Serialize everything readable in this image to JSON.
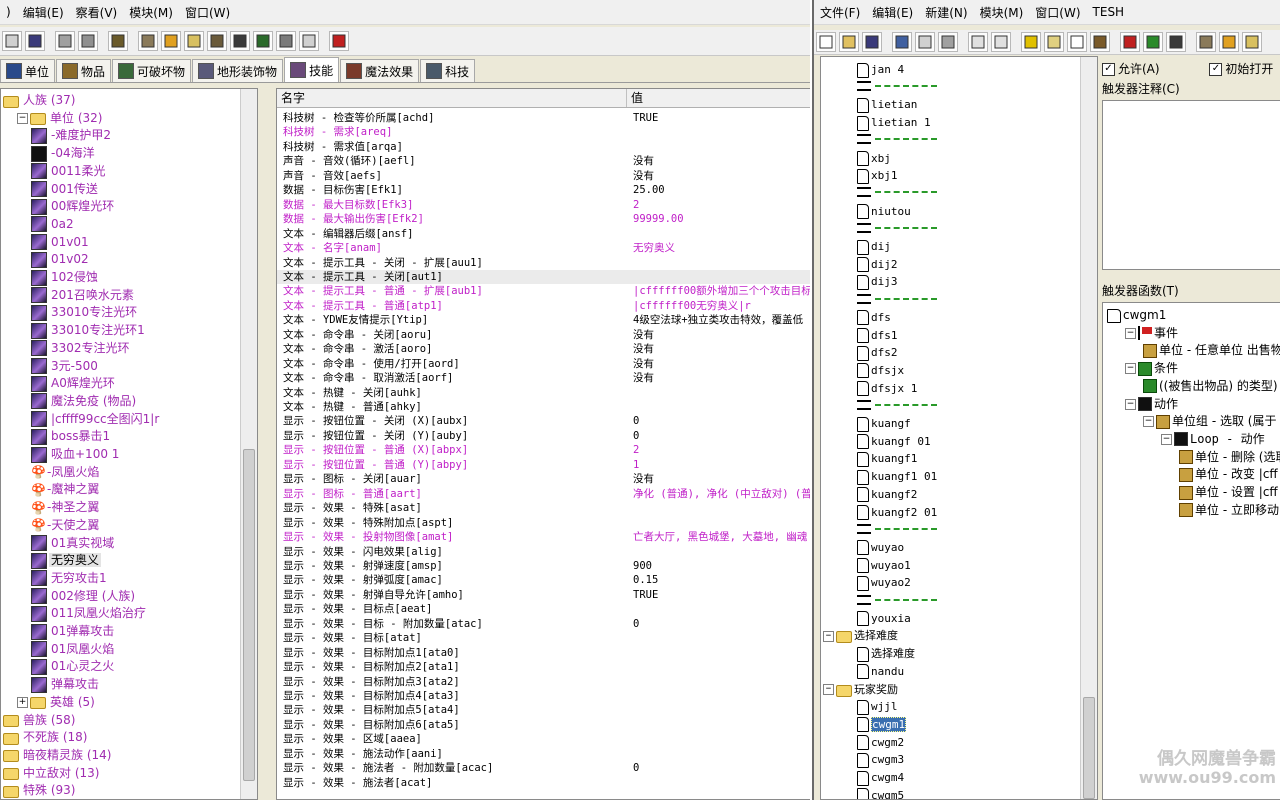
{
  "left_window": {
    "menu": [
      "编辑(E)",
      "察看(V)",
      "模块(M)",
      "窗口(W)"
    ],
    "tabs": [
      {
        "label": "单位",
        "active": false
      },
      {
        "label": "物品",
        "active": false
      },
      {
        "label": "可破坏物",
        "active": false
      },
      {
        "label": "地形装饰物",
        "active": false
      },
      {
        "label": "技能",
        "active": true
      },
      {
        "label": "魔法效果",
        "active": false
      },
      {
        "label": "科技",
        "active": false
      }
    ],
    "object_tree": [
      {
        "label": "人族 (37)",
        "level": 0,
        "type": "folder",
        "expanded": true,
        "color": "purple"
      },
      {
        "label": "单位 (32)",
        "level": 1,
        "type": "folder",
        "expanded": true,
        "color": "purple"
      },
      {
        "label": "-难度护甲2",
        "level": 2,
        "type": "unit",
        "color": "purple"
      },
      {
        "label": "-04海洋",
        "level": 2,
        "type": "dark",
        "color": "purple"
      },
      {
        "label": "0011柔光",
        "level": 2,
        "type": "unit",
        "color": "purple"
      },
      {
        "label": "001传送",
        "level": 2,
        "type": "unit",
        "color": "purple"
      },
      {
        "label": "00辉煌光环",
        "level": 2,
        "type": "unit",
        "color": "purple"
      },
      {
        "label": "0a2",
        "level": 2,
        "type": "unit",
        "color": "purple"
      },
      {
        "label": "01v01",
        "level": 2,
        "type": "unit",
        "color": "purple"
      },
      {
        "label": "01v02",
        "level": 2,
        "type": "unit",
        "color": "purple"
      },
      {
        "label": "102侵蚀",
        "level": 2,
        "type": "unit",
        "color": "purple"
      },
      {
        "label": "201召唤水元素",
        "level": 2,
        "type": "unit",
        "color": "purple"
      },
      {
        "label": "33010专注光环",
        "level": 2,
        "type": "unit",
        "color": "purple"
      },
      {
        "label": "33010专注光环1",
        "level": 2,
        "type": "unit",
        "color": "purple"
      },
      {
        "label": "3302专注光环",
        "level": 2,
        "type": "unit",
        "color": "purple"
      },
      {
        "label": "3元-500",
        "level": 2,
        "type": "unit",
        "color": "purple"
      },
      {
        "label": "A0辉煌光环",
        "level": 2,
        "type": "unit",
        "color": "purple"
      },
      {
        "label": "魔法免疫 (物品)",
        "level": 2,
        "type": "unit",
        "color": "purple"
      },
      {
        "label": "|cffff99cc全图闪1|r",
        "level": 2,
        "type": "unit",
        "color": "purple"
      },
      {
        "label": "boss暴击1",
        "level": 2,
        "type": "unit",
        "color": "purple"
      },
      {
        "label": "吸血+100 1",
        "level": 2,
        "type": "unit",
        "color": "purple"
      },
      {
        "label": "-凤凰火焰",
        "level": 2,
        "type": "ent",
        "color": "purple"
      },
      {
        "label": "-魔神之翼",
        "level": 2,
        "type": "ent",
        "color": "purple"
      },
      {
        "label": "-神圣之翼",
        "level": 2,
        "type": "ent",
        "color": "purple"
      },
      {
        "label": "-天使之翼",
        "level": 2,
        "type": "ent",
        "color": "purple"
      },
      {
        "label": "01真实视域",
        "level": 2,
        "type": "unit",
        "color": "purple"
      },
      {
        "label": "无穷奥义",
        "level": 2,
        "type": "unit",
        "color": "black",
        "selected": true
      },
      {
        "label": "无穷攻击1",
        "level": 2,
        "type": "unit",
        "color": "purple"
      },
      {
        "label": "002修理 (人族)",
        "level": 2,
        "type": "unit",
        "color": "purple"
      },
      {
        "label": "011凤凰火焰治疗",
        "level": 2,
        "type": "unit",
        "color": "purple"
      },
      {
        "label": "01弹幕攻击",
        "level": 2,
        "type": "unit",
        "color": "purple"
      },
      {
        "label": "01凤凰火焰",
        "level": 2,
        "type": "unit",
        "color": "purple"
      },
      {
        "label": "01心灵之火",
        "level": 2,
        "type": "unit",
        "color": "purple"
      },
      {
        "label": "弹幕攻击",
        "level": 2,
        "type": "unit",
        "color": "purple"
      },
      {
        "label": "英雄 (5)",
        "level": 1,
        "type": "folder",
        "expanded": false,
        "color": "purple"
      },
      {
        "label": "兽族 (58)",
        "level": 0,
        "type": "folder",
        "color": "purple"
      },
      {
        "label": "不死族 (18)",
        "level": 0,
        "type": "folder",
        "color": "purple"
      },
      {
        "label": "暗夜精灵族 (14)",
        "level": 0,
        "type": "folder",
        "color": "purple"
      },
      {
        "label": "中立敌对 (13)",
        "level": 0,
        "type": "folder",
        "color": "purple"
      },
      {
        "label": "特殊 (93)",
        "level": 0,
        "type": "folder",
        "color": "purple"
      }
    ],
    "grid": {
      "col_name": "名字",
      "col_value": "值",
      "rows": [
        {
          "k": "科技树 - 检查等价所属[achd]",
          "v": "TRUE",
          "mod": false
        },
        {
          "k": "科技树 - 需求[areq]",
          "v": "",
          "mod": true
        },
        {
          "k": "科技树 - 需求值[arqa]",
          "v": "",
          "mod": false
        },
        {
          "k": "声音 - 音效(循环)[aefl]",
          "v": "没有",
          "mod": false
        },
        {
          "k": "声音 - 音效[aefs]",
          "v": "没有",
          "mod": false
        },
        {
          "k": "数据 - 目标伤害[Efk1]",
          "v": "25.00",
          "mod": false
        },
        {
          "k": "数据 - 最大目标数[Efk3]",
          "v": "2",
          "mod": true
        },
        {
          "k": "数据 - 最大输出伤害[Efk2]",
          "v": "99999.00",
          "mod": true
        },
        {
          "k": "文本 - 编辑器后缀[ansf]",
          "v": "",
          "mod": false
        },
        {
          "k": "文本 - 名字[anam]",
          "v": " 无穷奥义",
          "mod": true
        },
        {
          "k": "文本 - 提示工具 - 关闭 - 扩展[auu1]",
          "v": "",
          "mod": false
        },
        {
          "k": "文本 - 提示工具 - 关闭[aut1]",
          "v": "",
          "mod": false,
          "sel": true
        },
        {
          "k": "文本 - 提示工具 - 普通 - 扩展[aub1]",
          "v": "|cffffff00额外增加三个个攻击目标",
          "mod": true
        },
        {
          "k": "文本 - 提示工具 - 普通[atp1]",
          "v": "|cffffff00无穷奥义|r",
          "mod": true
        },
        {
          "k": "文本 - YDWE友情提示[Ytip]",
          "v": "4级空法球+独立类攻击特效，覆盖低",
          "mod": false
        },
        {
          "k": "文本 - 命令串 - 关闭[aoru]",
          "v": "没有",
          "mod": false
        },
        {
          "k": "文本 - 命令串 - 激活[aoro]",
          "v": "没有",
          "mod": false
        },
        {
          "k": "文本 - 命令串 - 使用/打开[aord]",
          "v": "没有",
          "mod": false
        },
        {
          "k": "文本 - 命令串 - 取消激活[aorf]",
          "v": "没有",
          "mod": false
        },
        {
          "k": "文本 - 热键 - 关闭[auhk]",
          "v": "",
          "mod": false
        },
        {
          "k": "文本 - 热键 - 普通[ahky]",
          "v": "",
          "mod": false
        },
        {
          "k": "显示 - 按钮位置 - 关闭 (X)[aubx]",
          "v": "0",
          "mod": false
        },
        {
          "k": "显示 - 按钮位置 - 关闭 (Y)[auby]",
          "v": "0",
          "mod": false
        },
        {
          "k": "显示 - 按钮位置 - 普通 (X)[abpx]",
          "v": "2",
          "mod": true
        },
        {
          "k": "显示 - 按钮位置 - 普通 (Y)[abpy]",
          "v": "1",
          "mod": true
        },
        {
          "k": "显示 - 图标 - 关闭[auar]",
          "v": "没有",
          "mod": false
        },
        {
          "k": "显示 - 图标 - 普通[aart]",
          "v": "净化 (普通), 净化 (中立敌对) (普",
          "mod": true
        },
        {
          "k": "显示 - 效果 - 特殊[asat]",
          "v": "",
          "mod": false
        },
        {
          "k": "显示 - 效果 - 特殊附加点[aspt]",
          "v": "",
          "mod": false
        },
        {
          "k": "显示 - 效果 - 投射物图像[amat]",
          "v": "亡者大厅, 黑色城堡, 大墓地, 幽魂",
          "mod": true
        },
        {
          "k": "显示 - 效果 - 闪电效果[alig]",
          "v": "",
          "mod": false
        },
        {
          "k": "显示 - 效果 - 射弹速度[amsp]",
          "v": "900",
          "mod": false
        },
        {
          "k": "显示 - 效果 - 射弹弧度[amac]",
          "v": "0.15",
          "mod": false
        },
        {
          "k": "显示 - 效果 - 射弹自导允许[amho]",
          "v": "TRUE",
          "mod": false
        },
        {
          "k": "显示 - 效果 - 目标点[aeat]",
          "v": "",
          "mod": false
        },
        {
          "k": "显示 - 效果 - 目标 - 附加数量[atac]",
          "v": "0",
          "mod": false
        },
        {
          "k": "显示 - 效果 - 目标[atat]",
          "v": "",
          "mod": false
        },
        {
          "k": "显示 - 效果 - 目标附加点1[ata0]",
          "v": "",
          "mod": false
        },
        {
          "k": "显示 - 效果 - 目标附加点2[ata1]",
          "v": "",
          "mod": false
        },
        {
          "k": "显示 - 效果 - 目标附加点3[ata2]",
          "v": "",
          "mod": false
        },
        {
          "k": "显示 - 效果 - 目标附加点4[ata3]",
          "v": "",
          "mod": false
        },
        {
          "k": "显示 - 效果 - 目标附加点5[ata4]",
          "v": "",
          "mod": false
        },
        {
          "k": "显示 - 效果 - 目标附加点6[ata5]",
          "v": "",
          "mod": false
        },
        {
          "k": "显示 - 效果 - 区域[aaea]",
          "v": "",
          "mod": false
        },
        {
          "k": "显示 - 效果 - 施法动作[aani]",
          "v": "",
          "mod": false
        },
        {
          "k": "显示 - 效果 - 施法者 - 附加数量[acac]",
          "v": "0",
          "mod": false
        },
        {
          "k": "显示 - 效果 - 施法者[acat]",
          "v": "",
          "mod": false
        }
      ]
    }
  },
  "right_window": {
    "menu": [
      "文件(F)",
      "编辑(E)",
      "新建(N)",
      "模块(M)",
      "窗口(W)",
      "TESH"
    ],
    "trigger_tree": [
      {
        "t": "doc",
        "label": "jan 4"
      },
      {
        "t": "sep"
      },
      {
        "t": "doc",
        "label": "lietian"
      },
      {
        "t": "doc",
        "label": "lietian 1"
      },
      {
        "t": "sep"
      },
      {
        "t": "doc",
        "label": "xbj"
      },
      {
        "t": "doc",
        "label": "xbj1"
      },
      {
        "t": "sep"
      },
      {
        "t": "doc",
        "label": "niutou"
      },
      {
        "t": "sep"
      },
      {
        "t": "doc",
        "label": "dij"
      },
      {
        "t": "doc",
        "label": "dij2"
      },
      {
        "t": "doc",
        "label": "dij3"
      },
      {
        "t": "sep"
      },
      {
        "t": "doc",
        "label": "dfs"
      },
      {
        "t": "doc",
        "label": "dfs1"
      },
      {
        "t": "doc",
        "label": "dfs2"
      },
      {
        "t": "doc",
        "label": "dfsjx"
      },
      {
        "t": "doc",
        "label": "dfsjx 1"
      },
      {
        "t": "sep"
      },
      {
        "t": "doc",
        "label": "kuangf"
      },
      {
        "t": "doc",
        "label": "kuangf 01"
      },
      {
        "t": "doc",
        "label": "kuangf1"
      },
      {
        "t": "doc",
        "label": "kuangf1 01"
      },
      {
        "t": "doc",
        "label": "kuangf2"
      },
      {
        "t": "doc",
        "label": "kuangf2 01"
      },
      {
        "t": "sep"
      },
      {
        "t": "doc",
        "label": "wuyao"
      },
      {
        "t": "doc",
        "label": "wuyao1"
      },
      {
        "t": "doc",
        "label": "wuyao2"
      },
      {
        "t": "sep"
      },
      {
        "t": "doc",
        "label": "youxia"
      },
      {
        "t": "folder",
        "label": "选择难度"
      },
      {
        "t": "doc",
        "label": "选择难度"
      },
      {
        "t": "doc",
        "label": "nandu"
      },
      {
        "t": "folder",
        "label": "玩家奖励"
      },
      {
        "t": "doc",
        "label": "wjjl"
      },
      {
        "t": "doc",
        "label": "cwgm1",
        "selected": true
      },
      {
        "t": "doc",
        "label": "cwgm2"
      },
      {
        "t": "doc",
        "label": "cwgm3"
      },
      {
        "t": "doc",
        "label": "cwgm4"
      },
      {
        "t": "doc",
        "label": "cwgm5"
      }
    ],
    "checkbox_enabled": "允许(A)",
    "checkbox_initially_on": "初始打开",
    "comment_label": "触发器注释(C)",
    "functions_label": "触发器函数(T)",
    "functions": [
      {
        "label": "cwgm1",
        "level": 0,
        "icon": "doc"
      },
      {
        "label": "事件",
        "level": 1,
        "icon": "flag",
        "exp": true
      },
      {
        "label": "单位 - 任意单位 出售物品",
        "level": 2,
        "icon": "act"
      },
      {
        "label": "条件",
        "level": 1,
        "icon": "cond",
        "exp": true
      },
      {
        "label": "((被售出物品) 的类型)",
        "level": 2,
        "icon": "cond"
      },
      {
        "label": "动作",
        "level": 1,
        "icon": "clap",
        "exp": true
      },
      {
        "label": "单位组 - 选取 (属于 (",
        "level": 2,
        "icon": "act",
        "exp": true
      },
      {
        "label": "Loop - 动作",
        "level": 3,
        "icon": "clap",
        "exp": true
      },
      {
        "label": "单位 - 删除 (选取",
        "level": 4,
        "icon": "act"
      },
      {
        "label": "单位 - 改变 |cff",
        "level": 4,
        "icon": "act"
      },
      {
        "label": "单位 - 设置 |cff",
        "level": 4,
        "icon": "act"
      },
      {
        "label": "单位 - 立即移动",
        "level": 4,
        "icon": "act"
      }
    ]
  },
  "watermark": {
    "line1": "偶久网魔兽争霸",
    "line2": "www.ou99.com"
  }
}
